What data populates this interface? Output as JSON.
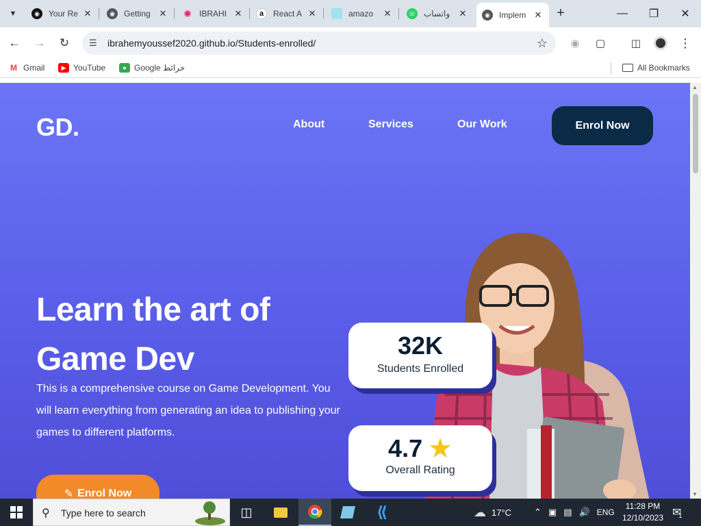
{
  "browser": {
    "tabs": [
      {
        "label": "Your Re",
        "icon": "github-icon"
      },
      {
        "label": "Getting",
        "icon": "globe-icon"
      },
      {
        "label": "IBRAHI",
        "icon": "react-icon"
      },
      {
        "label": "React A",
        "icon": "amazon-icon"
      },
      {
        "label": "amazo",
        "icon": "page-icon"
      },
      {
        "label": "واتساب",
        "icon": "whatsapp-icon"
      },
      {
        "label": "Implem",
        "icon": "globe-icon",
        "active": true
      }
    ],
    "url": "ibrahemyoussef2020.github.io/Students-enrolled/",
    "bookmarks": [
      {
        "label": "Gmail",
        "icon": "gmail-icon"
      },
      {
        "label": "YouTube",
        "icon": "youtube-icon"
      },
      {
        "label": "Google خرائط",
        "icon": "maps-icon"
      }
    ],
    "all_bookmarks": "All Bookmarks"
  },
  "site": {
    "logo": "GD.",
    "nav": [
      "About",
      "Services",
      "Our Work"
    ],
    "cta_top": "Enrol Now",
    "hero_title_line1": "Learn the art of",
    "hero_title_line2": "Game Dev",
    "hero_desc": "This is a comprehensive course on Game Development. You will learn everything from generating an idea to publishing your games to different platforms.",
    "cta_hero": "Enrol Now",
    "stats": [
      {
        "value": "32K",
        "label": "Students Enrolled"
      },
      {
        "value": "4.7",
        "label": "Overall Rating"
      }
    ]
  },
  "taskbar": {
    "search_placeholder": "Type here to search",
    "weather": "17°C",
    "language": "ENG",
    "time": "11:28 PM",
    "date": "12/10/2023",
    "notification_count": "1"
  },
  "colors": {
    "accent_dark": "#0b2a46",
    "accent_orange": "#f28a2a",
    "hero_bg": "#5a5ee9"
  }
}
